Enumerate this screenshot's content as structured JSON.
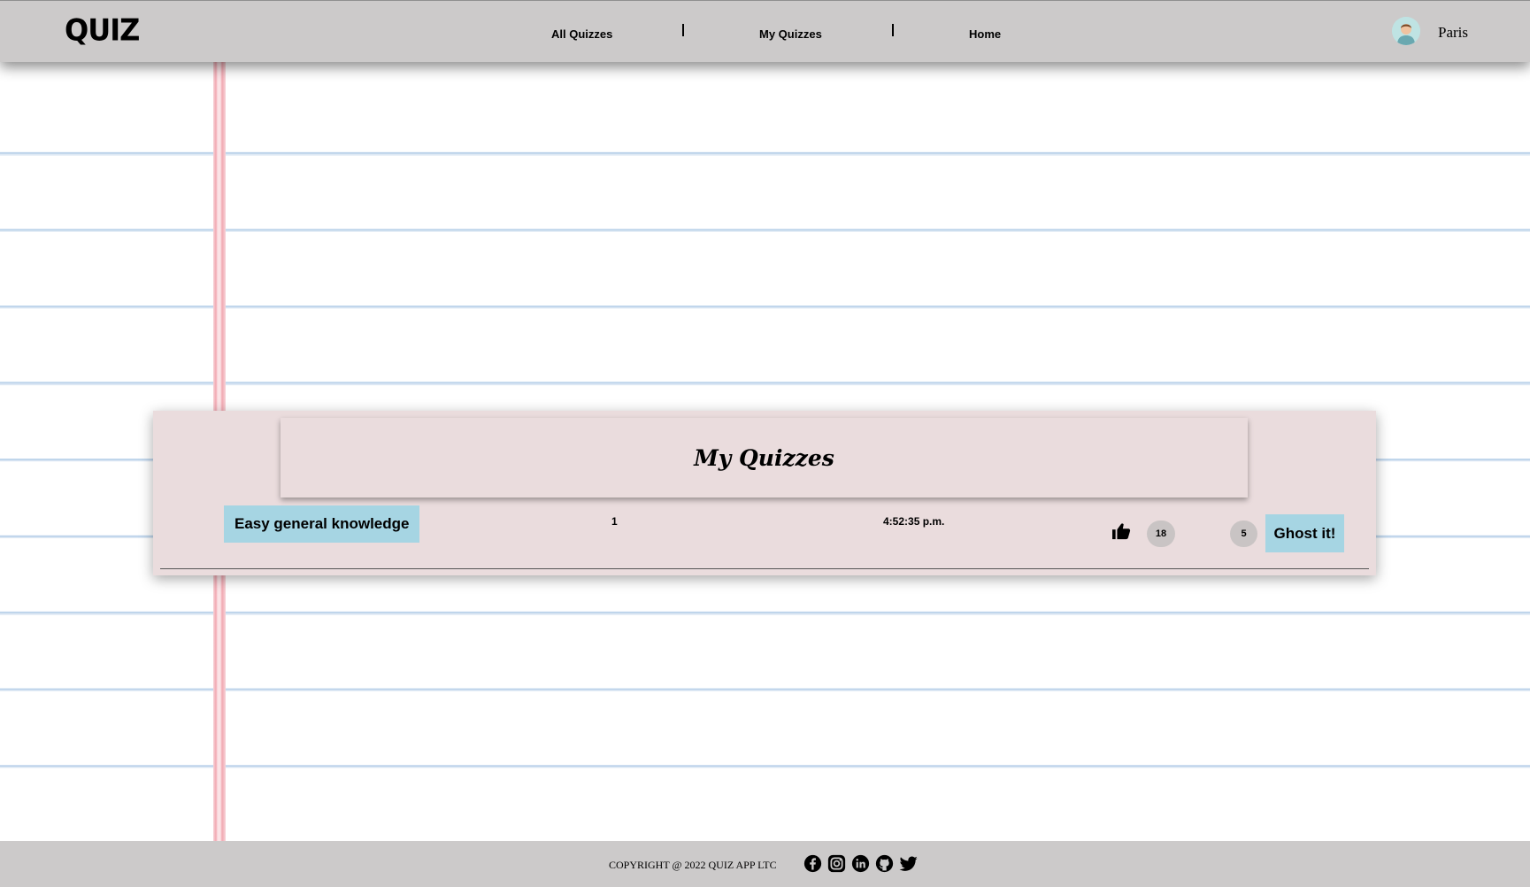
{
  "header": {
    "logo": "QUIZ",
    "nav": [
      {
        "label": "All Quizzes"
      },
      {
        "label": "My Quizzes"
      },
      {
        "label": "Home"
      }
    ],
    "username": "Paris"
  },
  "main": {
    "title": "My Quizzes",
    "quizzes": [
      {
        "name": "Easy general knowledge",
        "number": "1",
        "time": "4:52:35 p.m.",
        "likes": "18",
        "count": "5",
        "action_label": "Ghost it!"
      }
    ]
  },
  "footer": {
    "copyright": "COPYRIGHT @ 2022 QUIZ APP LTC",
    "social_icons": [
      "facebook-icon",
      "instagram-icon",
      "linkedin-icon",
      "github-icon",
      "twitter-icon"
    ]
  },
  "colors": {
    "header_bg": "#cccaca",
    "card_bg": "#eadcdd",
    "button_bg": "#a6d5e3",
    "badge_bg": "#c9c4c4",
    "notebook_line": "#bcd3ea",
    "margin_line": "#f2a8b2"
  }
}
